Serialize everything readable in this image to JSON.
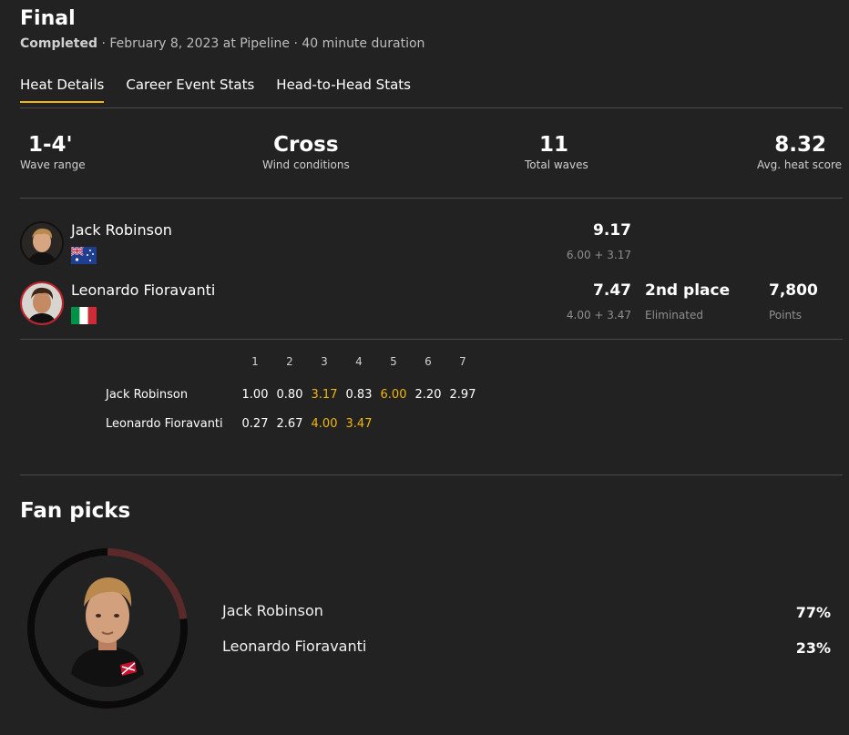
{
  "heat": {
    "title": "Final",
    "status": "Completed",
    "details": " · February 8, 2023 at Pipeline · 40 minute duration"
  },
  "tabs": [
    {
      "label": "Heat Details",
      "active": true
    },
    {
      "label": "Career Event Stats",
      "active": false
    },
    {
      "label": "Head-to-Head Stats",
      "active": false
    }
  ],
  "stats": [
    {
      "value": "1-4'",
      "label": "Wave range"
    },
    {
      "value": "Cross",
      "label": "Wind conditions"
    },
    {
      "value": "11",
      "label": "Total waves"
    },
    {
      "value": "8.32",
      "label": "Avg. heat score"
    }
  ],
  "surfers": [
    {
      "name": "Jack Robinson",
      "country_flag": "australia-flag-icon",
      "score": "9.17",
      "breakdown": "6.00 + 3.17"
    },
    {
      "name": "Leonardo Fioravanti",
      "country_flag": "italy-flag-icon",
      "score": "7.47",
      "breakdown": "4.00 + 3.47",
      "place": "2nd place",
      "place_note": "Eliminated",
      "points": "7,800",
      "points_label": "Points"
    }
  ],
  "wave_headers": [
    "1",
    "2",
    "3",
    "4",
    "5",
    "6",
    "7"
  ],
  "wave_rows": [
    {
      "name": "Jack Robinson",
      "waves": [
        "1.00",
        "0.80",
        "3.17",
        "0.83",
        "6.00",
        "2.20",
        "2.97"
      ],
      "counted": [
        2,
        4
      ]
    },
    {
      "name": "Leonardo Fioravanti",
      "waves": [
        "0.27",
        "2.67",
        "4.00",
        "3.47"
      ],
      "counted": [
        2,
        3
      ]
    }
  ],
  "fan_picks": {
    "title": "Fan picks",
    "ring_fraction": 0.77,
    "picks": [
      {
        "name": "Jack Robinson",
        "percent": "77%"
      },
      {
        "name": "Leonardo Fioravanti",
        "percent": "23%"
      }
    ]
  },
  "colors": {
    "accent": "#f2b705",
    "loser": "#c0222a",
    "ring_minor": "#5a2a2a",
    "ring_major": "#0a0a0a"
  }
}
